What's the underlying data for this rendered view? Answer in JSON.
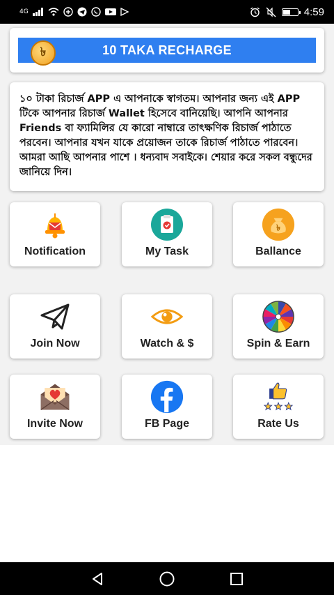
{
  "status_bar": {
    "network": "4G",
    "time": "4:59",
    "battery_level": 0.55
  },
  "header": {
    "title": "10 TAKA RECHARGE",
    "coin_symbol": "৳"
  },
  "message": {
    "text": "১০ টাকা রিচার্জ APP এ আপনাকে স্বাগতম। আপনার জন্য এই APP টিকে আপনার রিচার্জ Wallet হিসেবে বানিয়েছি। আপনি আপনার Friends বা ফ্যামিলির যে কারো নাম্বারে তাৎক্ষণিক রিচার্জ পাঠাতে পরবেন। আপনার যখন যাকে প্রয়োজন তাকে রিচার্জ পাঠাতে পারবেন। আমরা আছি আপনার পাশে । ধন্যবাদ সবাইকে। শেয়ার করে সকল বন্ধুদের জানিয়ে দিন।"
  },
  "menu": {
    "notification": "Notification",
    "my_task": "My Task",
    "ballance": "Ballance",
    "join_now": "Join Now",
    "watch": "Watch & $",
    "spin": "Spin & Earn",
    "invite": "Invite Now",
    "fb_page": "FB Page",
    "rate_us": "Rate Us"
  },
  "colors": {
    "header_bar": "#2f7ff0",
    "coin": "#f0a020",
    "task_icon": "#1aa79a",
    "facebook": "#1877f2"
  }
}
